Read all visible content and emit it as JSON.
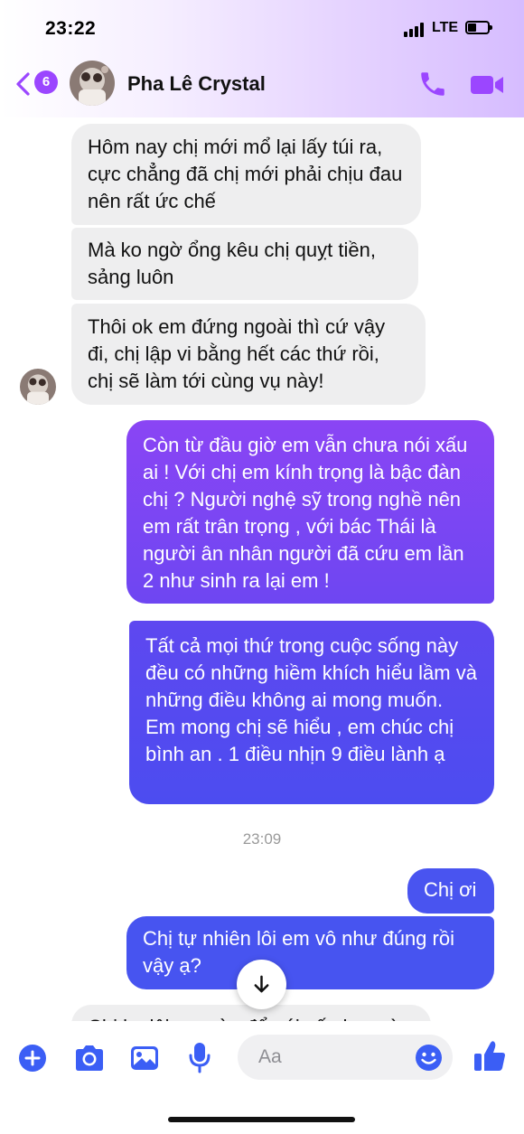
{
  "status_bar": {
    "time": "23:22",
    "network": "LTE",
    "battery_level": 0.45
  },
  "header": {
    "unread_count": "6",
    "contact_name": "Pha Lê Crystal"
  },
  "messages": [
    {
      "direction": "in",
      "text": "Hôm nay chị mới mổ lại lấy túi ra, cực chẳng đã chị mới phải chịu đau nên rất ức chế"
    },
    {
      "direction": "in",
      "text": "Mà ko ngờ ổng kêu chị quỵt tiền, sảng luôn"
    },
    {
      "direction": "in",
      "text": "Thôi ok em đứng ngoài thì cứ vậy đi, chị lập vi bằng hết các thứ rồi, chị sẽ làm tới cùng vụ này!"
    },
    {
      "direction": "out",
      "text": "Còn từ đầu giờ em vẫn chưa nói xấu ai ! Với chị em kính trọng là bậc đàn chị ? Người nghệ sỹ trong nghề nên em rất trân trọng , với bác Thái là người ân nhân người đã cứu em lần 2 như sinh ra lại em !"
    },
    {
      "direction": "out",
      "text": "Tất cả mọi thứ trong cuộc sống này đều có những hiềm khích hiểu lầm và những điều không ai mong muốn. Em mong chị sẽ hiểu , em chúc chị bình an . 1 điều nhịn 9 điều lành ạ"
    },
    {
      "direction": "out",
      "text": "Chị ơi"
    },
    {
      "direction": "out",
      "text": "Chị tự nhiên lôi em vô như đúng rồi vậy ạ?"
    },
    {
      "direction": "in",
      "text": "Chị ko lôi em vào để nói xấu hay gì"
    }
  ],
  "timestamp": "23:09",
  "composer": {
    "placeholder": "Aa"
  },
  "colors": {
    "accent": "#9b46ff",
    "incoming_bubble": "#eeeeef",
    "outgoing_top": "#8a45f4",
    "outgoing_bottom": "#4754f0",
    "composer_icon": "#3b5ef5"
  },
  "icons": [
    "back-chevron-icon",
    "phone-icon",
    "video-camera-icon",
    "arrow-down-icon",
    "plus-icon",
    "camera-icon",
    "image-icon",
    "microphone-icon",
    "emoji-icon",
    "thumbs-up-icon"
  ]
}
